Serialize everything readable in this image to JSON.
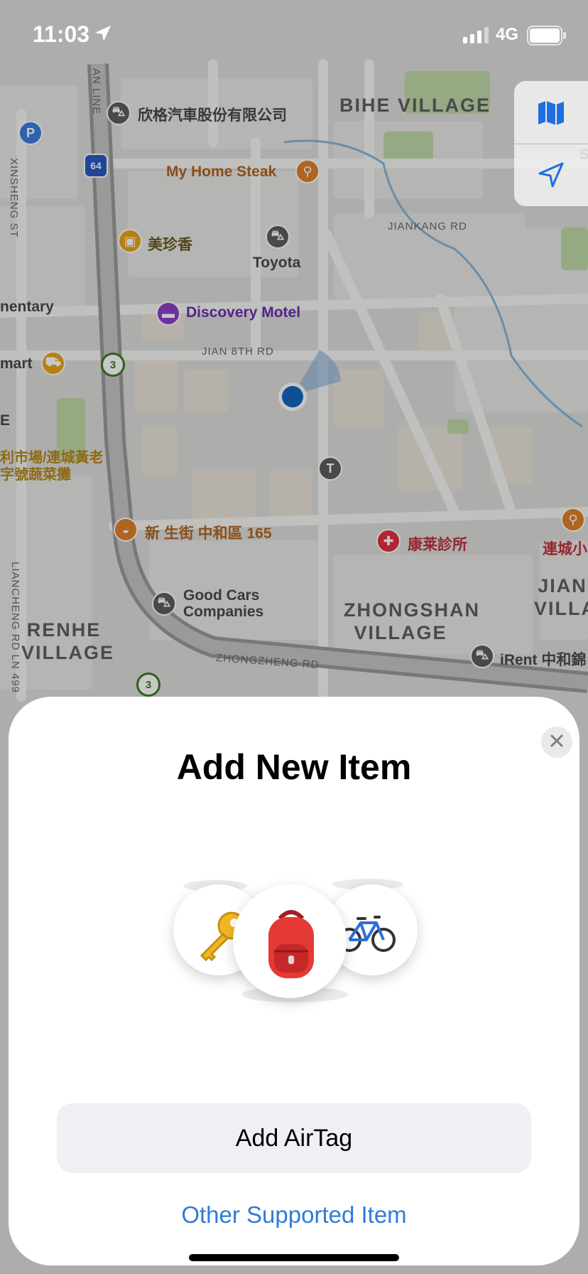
{
  "status_bar": {
    "time": "11:03",
    "network": "4G",
    "icons": [
      "location-arrow-icon",
      "signal-icon",
      "battery-icon"
    ]
  },
  "map": {
    "pois": [
      {
        "name": "欣格汽車股份有限公司",
        "icon": "car-service-icon",
        "color": "#5e5e5e"
      },
      {
        "name": "My Home Steak",
        "icon": "fork-knife-icon",
        "color": "#e0812a"
      },
      {
        "name": "美珍香",
        "icon": "shopping-bag-icon",
        "color": "#e9a418"
      },
      {
        "name": "Toyota",
        "icon": "car-service-icon",
        "color": "#5e5e5e"
      },
      {
        "name": "Discovery Motel",
        "icon": "bed-icon",
        "color": "#8a3fc9"
      },
      {
        "name": "新 生街 中和區 165",
        "icon": "bakery-icon",
        "color": "#e0812a"
      },
      {
        "name": "康莱診所",
        "icon": "stethoscope-icon",
        "color": "#e0313f"
      },
      {
        "name": "Good Cars Companies",
        "icon": "car-service-icon",
        "color": "#5e5e5e"
      },
      {
        "name": "iRent 中和錦",
        "icon": "car-service-icon",
        "color": "#5e5e5e"
      },
      {
        "name": "連城小",
        "icon": "fork-knife-icon",
        "color": "#e0812a"
      },
      {
        "name": "mart",
        "icon": "shopping-cart-icon",
        "color": "#e9a418"
      },
      {
        "name": "利市場/連城黃老字號蔬菜攤",
        "icon": "",
        "color": "#b58a1a"
      },
      {
        "name": "nentary",
        "icon": "",
        "color": "#4a4a4a"
      }
    ],
    "districts": [
      "BIHE VILLAGE",
      "ZHONGSHAN VILLAGE",
      "RENHE VILLAGE",
      "JIAN VILLA"
    ],
    "roads": [
      "JIANKANG RD",
      "JIAN 8TH RD",
      "ZHONGZHENG RD",
      "XINSHENG ST",
      "LIANCHENG RD LN 499",
      "AN LINE"
    ],
    "shields": [
      "64",
      "3",
      "3"
    ],
    "edge_text": [
      "St",
      "E"
    ],
    "controls": [
      "map-mode-icon",
      "location-arrow-icon"
    ]
  },
  "sheet": {
    "title": "Add New Item",
    "close_icon": "close-icon",
    "illustration": [
      "key-icon",
      "backpack-icon",
      "bicycle-icon"
    ],
    "primary_button": "Add AirTag",
    "secondary_link": "Other Supported Item",
    "accent_color": "#2f7bd9"
  }
}
